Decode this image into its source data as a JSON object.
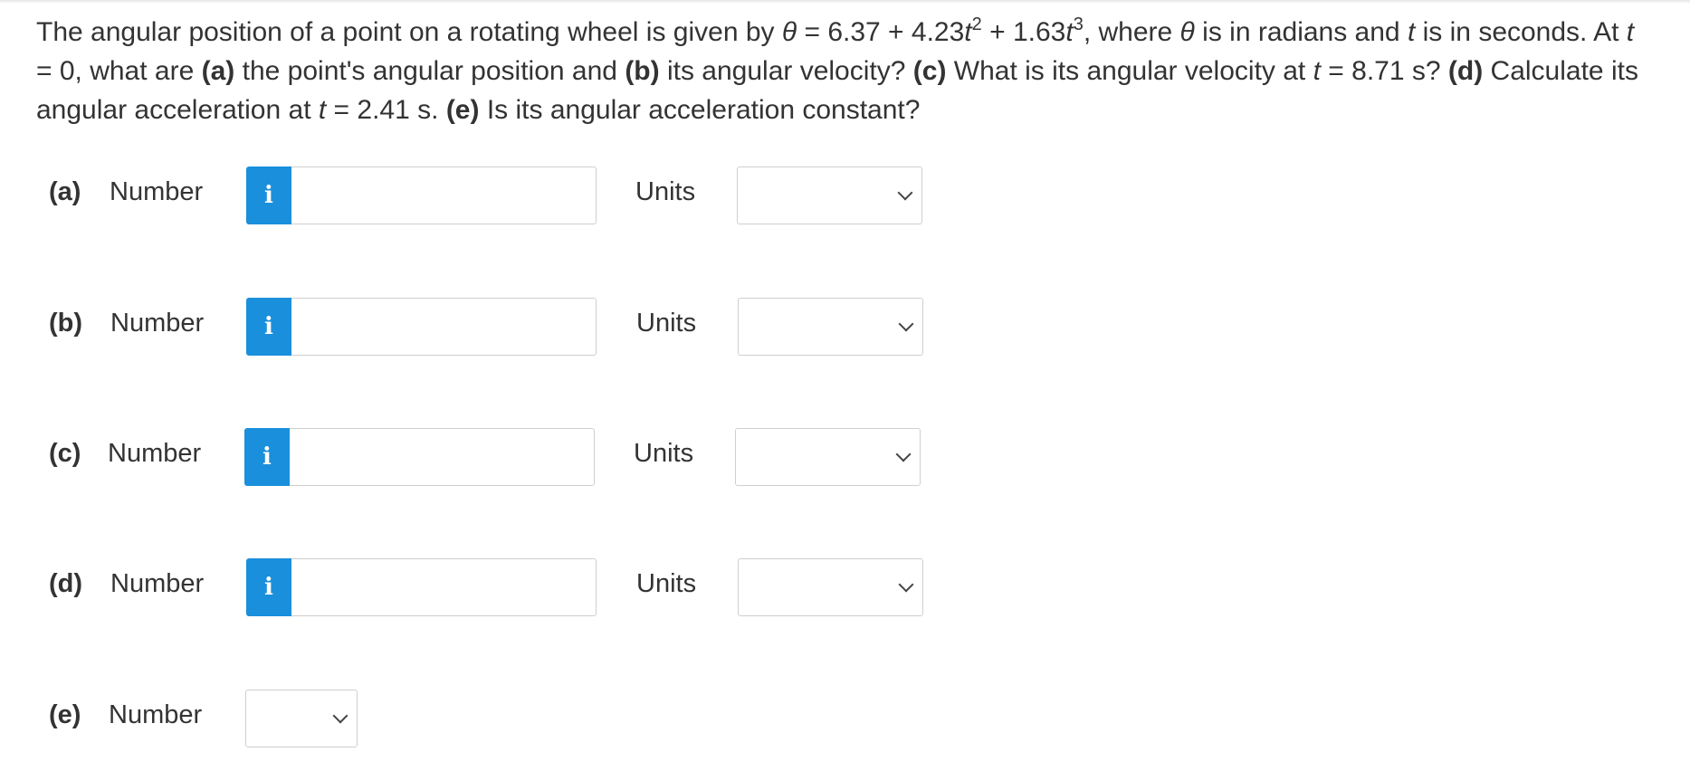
{
  "question": {
    "t1": "The angular position of a point on a rotating wheel is given by ",
    "theta": "θ",
    "t2": " = 6.37 + 4.23",
    "t": "t",
    "sup2": "2",
    "t3": " + 1.63",
    "sup3": "3",
    "t4": ", where ",
    "t5": " is in radians and ",
    "t6": " is in seconds. At ",
    "t7": " = 0, what are ",
    "a": "(a)",
    "t8": " the point's angular position and ",
    "b": "(b)",
    "t9": " its angular velocity? ",
    "c": "(c)",
    "t10": " What is its angular velocity at ",
    "t11": " = 8.71 s? ",
    "d": "(d)",
    "t12": " Calculate its angular acceleration at ",
    "t13": " = 2.41 s. ",
    "e": "(e)",
    "t14": " Is its angular acceleration constant?"
  },
  "parts": [
    {
      "label": "(a)",
      "field_label": "Number",
      "info": "i",
      "value": "",
      "units_label": "Units",
      "units_value": ""
    },
    {
      "label": "(b)",
      "field_label": "Number",
      "info": "i",
      "value": "",
      "units_label": "Units",
      "units_value": ""
    },
    {
      "label": "(c)",
      "field_label": "Number",
      "info": "i",
      "value": "",
      "units_label": "Units",
      "units_value": ""
    },
    {
      "label": "(d)",
      "field_label": "Number",
      "info": "i",
      "value": "",
      "units_label": "Units",
      "units_value": ""
    },
    {
      "label": "(e)",
      "field_label": "Number",
      "value": ""
    }
  ],
  "colors": {
    "info_button": "#1a8fdc",
    "text": "#333333",
    "border": "#cfcfcf"
  },
  "icons": {
    "info": "info-icon",
    "dropdown": "chevron-down-icon"
  }
}
